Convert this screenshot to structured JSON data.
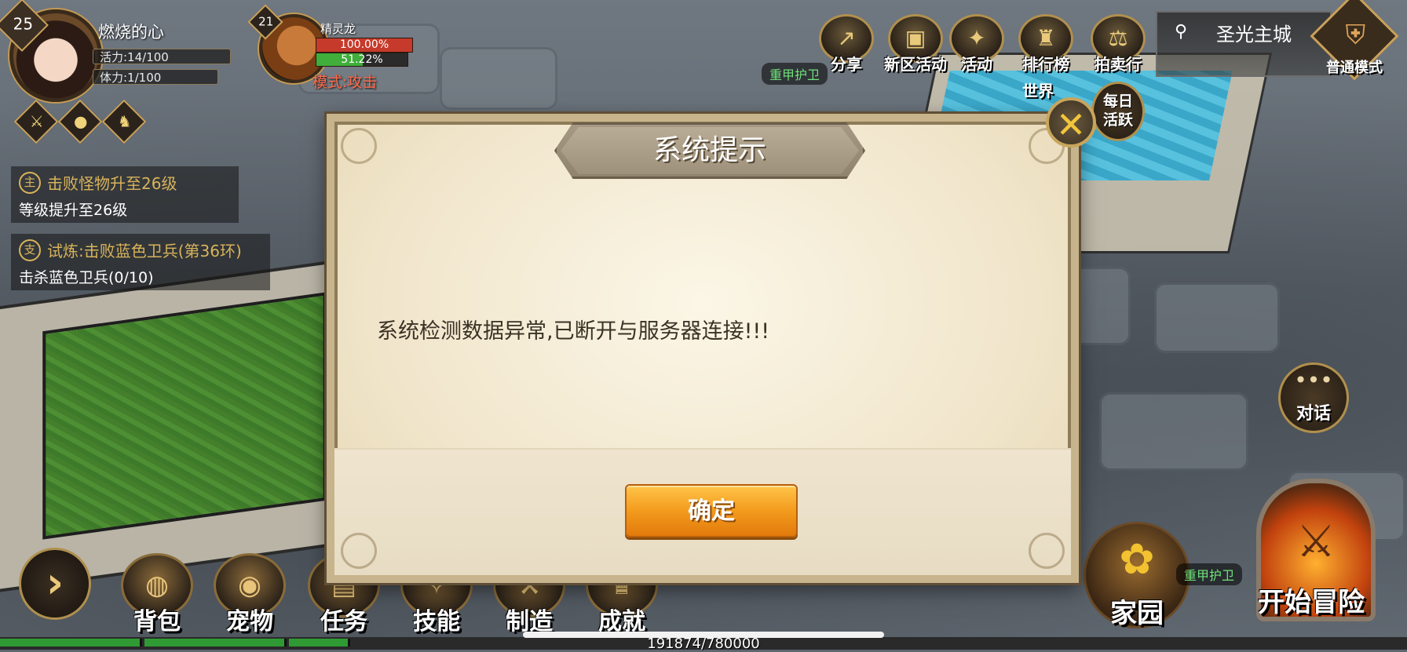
{
  "player": {
    "level": "25",
    "name": "燃烧的心",
    "vitality": "活力:14/100",
    "stamina": "体力:1/100"
  },
  "pet": {
    "level": "21",
    "name": "精灵龙",
    "hp_text": "100.00%",
    "xp_text": "51.22%",
    "xp_fraction": 0.5122,
    "mode": "模式:攻击"
  },
  "buffs": {
    "icons": [
      "power-up-icon",
      "acorn-icon",
      "horse-icon"
    ]
  },
  "quests": {
    "main": {
      "tag": "主",
      "title": "击败怪物升至26级",
      "desc": "等级提升至26级"
    },
    "branch": {
      "tag": "支",
      "title": "试炼:击败蓝色卫兵(第36环)",
      "desc": "击杀蓝色卫兵(0/10)"
    }
  },
  "top_menu": {
    "share": "分享",
    "new_server_event": "新区活动",
    "events": "活动",
    "ranking": "排行榜",
    "auction": "拍卖行"
  },
  "location": {
    "name": "圣光主城",
    "mode": "普通模式"
  },
  "npc_tags": {
    "top": "重甲护卫",
    "bottom": "重甲护卫"
  },
  "side": {
    "world": "世界",
    "daily_line1": "每日",
    "daily_line2": "活跃",
    "chat": "对话",
    "home": "家园",
    "adventure": "开始冒险"
  },
  "bottom_menu": {
    "bag": "背包",
    "pet": "宠物",
    "task": "任务",
    "skill": "技能",
    "craft": "制造",
    "achievement": "成就"
  },
  "exp": {
    "text": "191874/780000"
  },
  "dialog": {
    "title": "系统提示",
    "message": "系统检测数据异常,已断开与服务器连接!!!",
    "confirm": "确定"
  },
  "colors": {
    "quest_gold": "#d8b35a",
    "confirm_orange": "#f39b1d",
    "hp_red": "#c63a2b",
    "xp_green": "#3fae3a",
    "npc_green": "#6fe27a"
  }
}
